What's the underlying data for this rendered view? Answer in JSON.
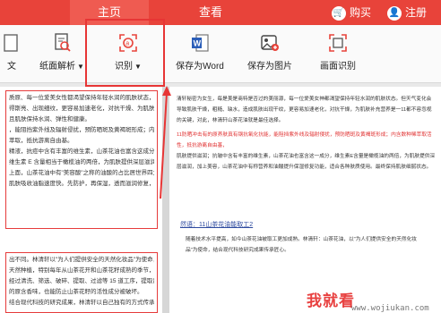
{
  "topbar": {
    "tabs": [
      {
        "label": "主页"
      },
      {
        "label": "查看"
      }
    ],
    "buy_label": "购买",
    "register_label": "注册"
  },
  "toolbar": {
    "items": [
      {
        "label": "文"
      },
      {
        "label": "纸面解析"
      },
      {
        "label": "识别"
      },
      {
        "label": "保存为Word"
      },
      {
        "label": "保存为图片"
      },
      {
        "label": "画面识别"
      }
    ]
  },
  "left_doc": {
    "lines_block1": [
      "质原、每一位爱美女性都渴望保持年轻水润的肌肤状态，但天",
      "得斯亮、出现细纹，更容易加速老化，对抗干燥、为肌肤补充营",
      "且肌肤保持水润、弹性和健康。",
      "，能阻挡紫外线及辐射侵扰，预防晒斑及黄褐斑形成；内含糯质",
      "萃取，抵抗游离自由基。",
      "精液，抗痘中含有丰富的维生素，山茶花油也富含这成分。",
      "维生素 E 含量相当于橄榄油的两倍，为肌肤提供深层滋润，加",
      "上面，山茶花油中有\"美容酸\"之称的油酸的占比居世界四大木本",
      "肌肤吸收油脂速度快。先防护，再保湿，透而滋润修复，一瓶就"
    ],
    "lines_block2": [
      "出不同。林清轩以\"为人们提供安全的天然化妆品\"为使命，从",
      "天然种植，特别每年从山茶花开和山茶花籽成熟的季节，科研人员",
      "经过清洗、筛选、破碎、提取、过滤等 15 道工序，提取出有效",
      "的原含香味，也能防止山茶花籽的活性成分被破坏。",
      "结合现代科技的研究成果，林清轩以自己独有的方式传承\"匠心\""
    ]
  },
  "right_doc": {
    "para1": "清轩秘密为女生，每是美是商特是否过的美丽源，每一位爱美女神都渴望保持年轻水润的肌肤状态。但天气变化会导致肌肤干燥，粗糙、缺水，造成肌肤出现干纹，更容易加速老化，对抗干燥，为肌肤补充营养是一11都不容忽视的关键，对此，林清轩山茶花油就是最佳选择。",
    "para2_red": "11防晒冲击有的原养肤真有钢抗氧化抗能，能阻挡紫外线及辐射侵扰，预防晒斑及黄褐斑形成；内含数种稀萃取活性，抵抗游离自由基，",
    "para2": "肌肤提供滋润；抗皱中含有丰富的维生素，山茶花油也富含这一成分，维生素E含量是橄榄油的两倍，为肌肤提供深层滋润，加上美容，山茶花油中有称营养和油酸提升保湿修复功能，适合各种肤质使用。最终保持肌肤细腻状态。",
    "title": "然语：11山茶花油能取工2",
    "para3": "随着技术水平提高，如今山茶花油被取工更加成熟。林清轩：山茶花油，以\"为人们提供安全的天然化妆品\"为使命，结合现代科技研究成果传承匠心。"
  },
  "watermark": {
    "big": "我就看",
    "small": "www.wojiukan.com"
  }
}
